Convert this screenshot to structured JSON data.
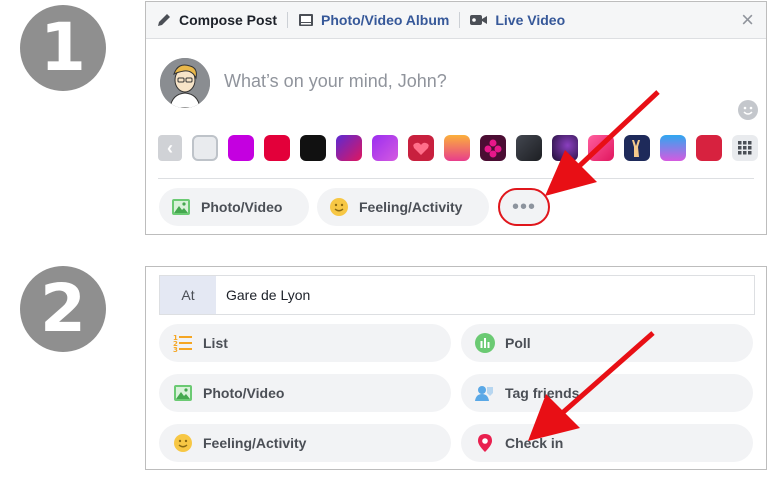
{
  "steps": {
    "one": "1",
    "two": "2"
  },
  "panel1": {
    "tabs": {
      "compose": "Compose Post",
      "album": "Photo/Video Album",
      "live": "Live Video"
    },
    "close": "×",
    "placeholder": "What’s on your mind, John?",
    "swatch_colors": [
      "#e9ebee",
      "#c400e0",
      "#e3003a",
      "#111111",
      "#b12494",
      "#b14df0",
      "#d6214a",
      "#f6a14d",
      "#4b0d33",
      "#2a2c30",
      "#3d1b5c",
      "#f03d7a",
      "#1e2a5a",
      "#b85dd9",
      "#d7223f"
    ],
    "more_label": "•••",
    "actions": {
      "photo": "Photo/Video",
      "feeling": "Feeling/Activity"
    }
  },
  "panel2": {
    "at_label": "At",
    "at_value": "Gare de Lyon",
    "actions": {
      "list": "List",
      "poll": "Poll",
      "photo": "Photo/Video",
      "tag": "Tag friends",
      "feeling": "Feeling/Activity",
      "checkin": "Check in"
    }
  },
  "colors": {
    "arrow": "#e80f15",
    "link": "#365899",
    "step_circle": "#8f8f8f"
  }
}
